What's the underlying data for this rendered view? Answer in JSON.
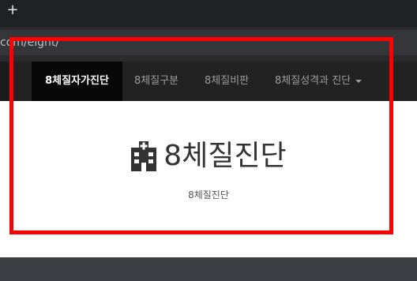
{
  "browser": {
    "new_tab_label": "+",
    "url": "com/eight/"
  },
  "navbar": {
    "brand": "8체질자가진단",
    "items": [
      "8체질구분",
      "8체질비판",
      "8체질성격과 진단"
    ]
  },
  "hero": {
    "title": "8체질진단",
    "subtitle": "8체질진단",
    "icon": "hospital-icon"
  },
  "annotation": {
    "color": "#ff0000"
  }
}
